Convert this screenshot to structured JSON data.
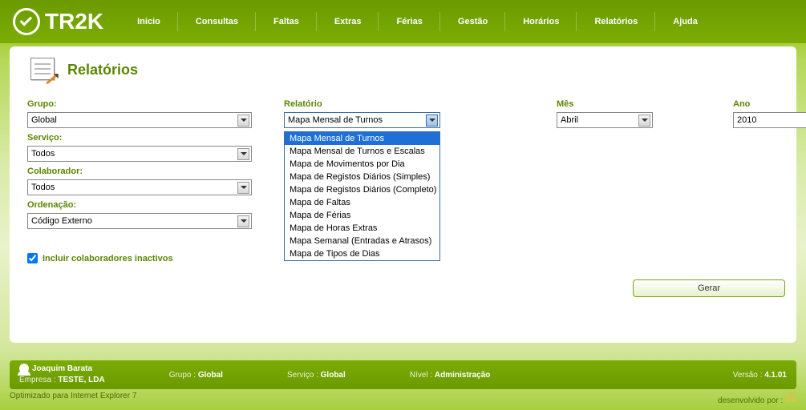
{
  "brand": "TR2K",
  "nav": [
    "Inicio",
    "Consultas",
    "Faltas",
    "Extras",
    "Férias",
    "Gestão",
    "Horários",
    "Relatórios",
    "Ajuda"
  ],
  "page": {
    "title": "Relatórios"
  },
  "grupo": {
    "label": "Grupo:",
    "value": "Global"
  },
  "servico": {
    "label": "Serviço:",
    "value": "Todos"
  },
  "colaborador": {
    "label": "Colaborador:",
    "value": "Todos"
  },
  "ordenacao": {
    "label": "Ordenação:",
    "value": "Código Externo"
  },
  "relatorio": {
    "label": "Relatório",
    "value": "Mapa Mensal de Turnos",
    "options": [
      "Mapa Mensal de Turnos",
      "Mapa Mensal de Turnos e Escalas",
      "Mapa de Movimentos por Dia",
      "Mapa de Registos Diários (Simples)",
      "Mapa de Registos Diários (Completo)",
      "Mapa de Faltas",
      "Mapa de Férias",
      "Mapa de Horas Extras",
      "Mapa Semanal (Entradas e Atrasos)",
      "Mapa de Tipos de Dias"
    ]
  },
  "mes": {
    "label": "Mês",
    "value": "Abril"
  },
  "ano": {
    "label": "Ano",
    "value": "2010"
  },
  "gerar": "Gerar",
  "inactivos": {
    "label": "Incluir colaboradores inactivos",
    "checked": true
  },
  "status": {
    "user": "Joaquim Barata",
    "empresa_label": "Empresa :",
    "empresa": "TESTE, LDA",
    "grupo_label": "Grupo :",
    "grupo": "Global",
    "servico_label": "Serviço :",
    "servico": "Global",
    "nivel_label": "Nível :",
    "nivel": "Administração",
    "versao_label": "Versão :",
    "versao": "4.1.01"
  },
  "footer": {
    "left": "Optimizado para Internet Explorer 7",
    "right": "desenvolvido por :"
  }
}
